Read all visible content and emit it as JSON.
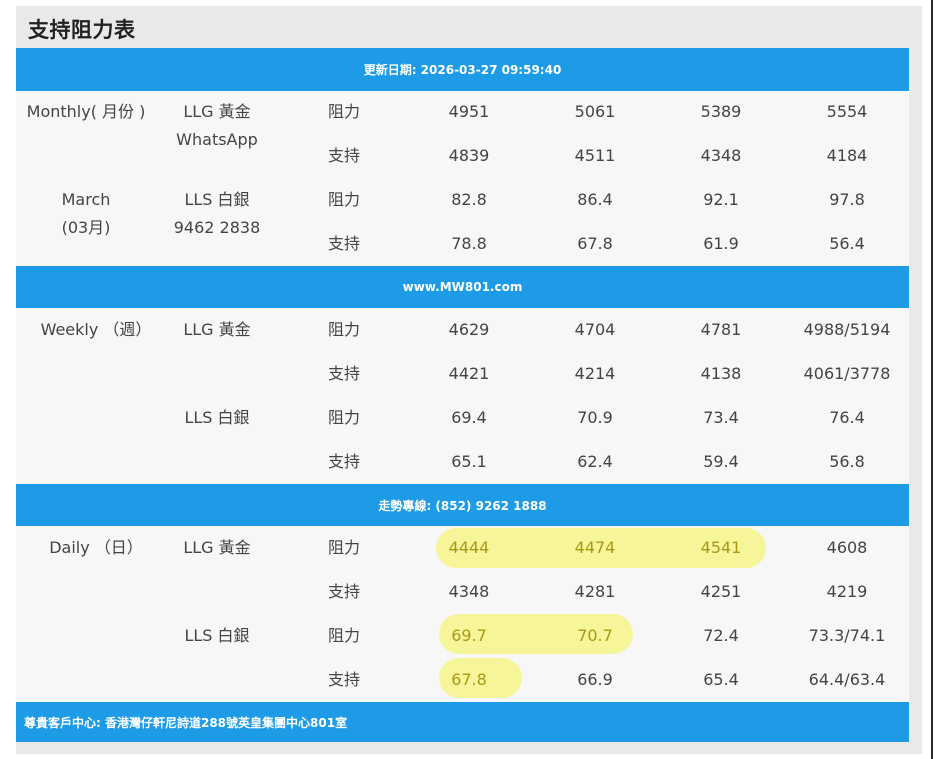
{
  "title": "支持阻力表",
  "bands": {
    "updated": "更新日期: 2026-03-27 09:59:40",
    "website": "www.MW801.com",
    "hotline": "走勢專線: (852) 9262 1888",
    "address": "尊貴客戶中心: 香港灣仔軒尼詩道288號英皇集團中心801室"
  },
  "monthly": {
    "period_line1": "Monthly( 月份 )",
    "period_line2": "March",
    "period_line3": "(03月)",
    "gold_label": "LLG 黃金",
    "whatsapp_label": "WhatsApp",
    "silver_label": "LLS 白銀",
    "phone": "9462 2838",
    "gold_res": [
      "阻力",
      "4951",
      "5061",
      "5389",
      "5554"
    ],
    "gold_sup": [
      "支持",
      "4839",
      "4511",
      "4348",
      "4184"
    ],
    "silver_res": [
      "阻力",
      "82.8",
      "86.4",
      "92.1",
      "97.8"
    ],
    "silver_sup": [
      "支持",
      "78.8",
      "67.8",
      "61.9",
      "56.4"
    ]
  },
  "weekly": {
    "period": "Weekly （週）",
    "gold_label": "LLG 黃金",
    "silver_label": "LLS 白銀",
    "gold_res": [
      "阻力",
      "4629",
      "4704",
      "4781",
      "4988/5194"
    ],
    "gold_sup": [
      "支持",
      "4421",
      "4214",
      "4138",
      "4061/3778"
    ],
    "silver_res": [
      "阻力",
      "69.4",
      "70.9",
      "73.4",
      "76.4"
    ],
    "silver_sup": [
      "支持",
      "65.1",
      "62.4",
      "59.4",
      "56.8"
    ]
  },
  "daily": {
    "period": "Daily （日）",
    "gold_label": "LLG 黃金",
    "silver_label": "LLS 白銀",
    "gold_res": [
      "阻力",
      "4444",
      "4474",
      "4541",
      "4608"
    ],
    "gold_sup": [
      "支持",
      "4348",
      "4281",
      "4251",
      "4219"
    ],
    "silver_res": [
      "阻力",
      "69.7",
      "70.7",
      "72.4",
      "73.3/74.1"
    ],
    "silver_sup": [
      "支持",
      "67.8",
      "66.9",
      "65.4",
      "64.4/63.4"
    ]
  },
  "highlight_color": "#f6f59a",
  "band_color": "#1e9be6"
}
